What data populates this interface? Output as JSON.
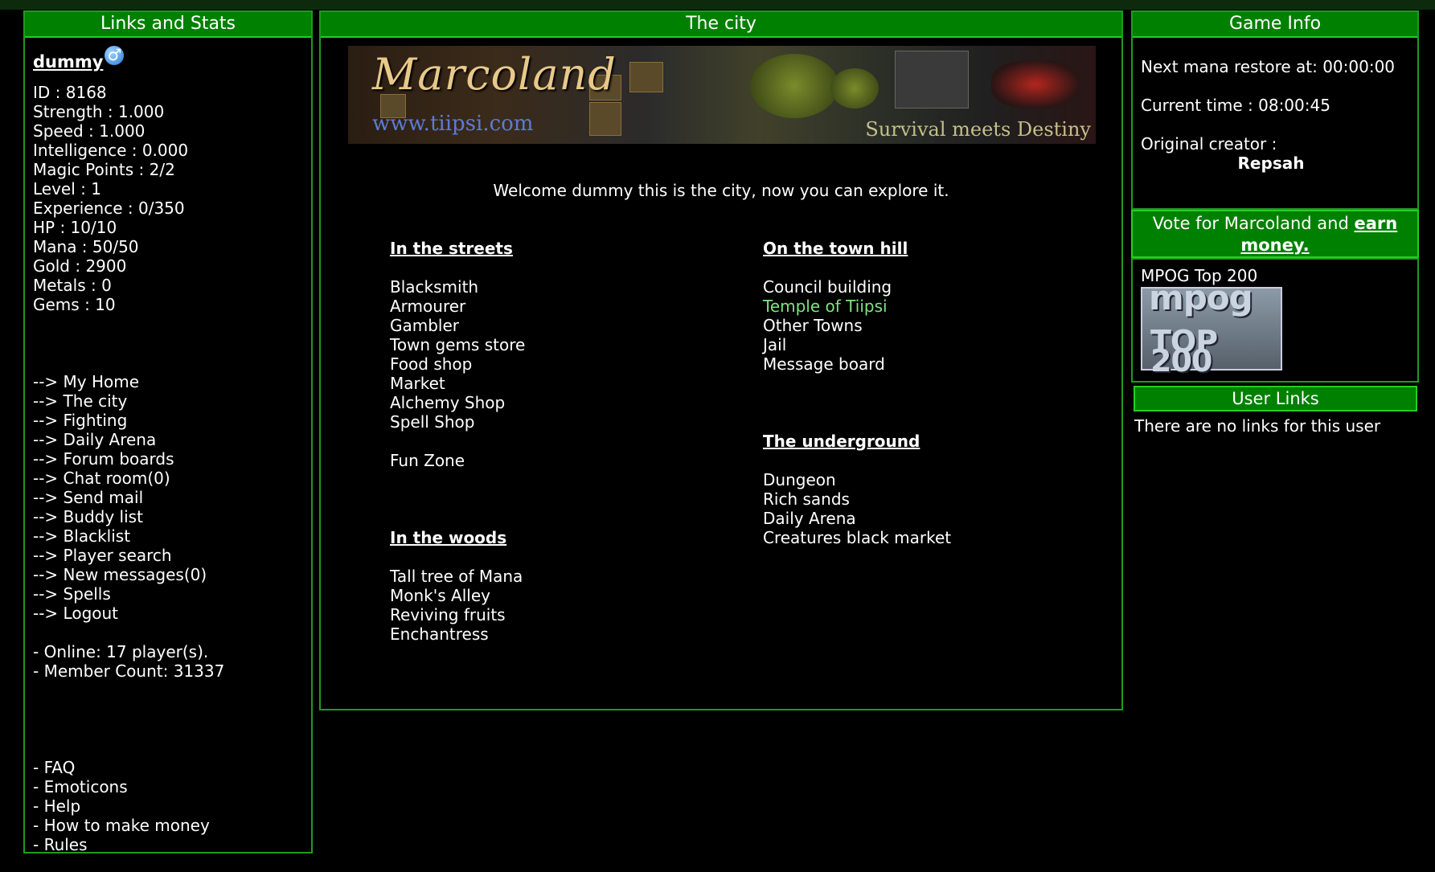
{
  "left": {
    "header": "Links and Stats",
    "username": "dummy",
    "gender_glyph": "♂",
    "stats": [
      "ID : 8168",
      "Strength : 1.000",
      "Speed : 1.000",
      "Intelligence : 0.000",
      "Magic Points : 2/2",
      "Level : 1",
      "Experience : 0/350",
      "HP : 10/10",
      "Mana : 50/50",
      "Gold : 2900",
      "Metals : 0",
      "Gems : 10"
    ],
    "nav": [
      "--> My Home",
      "--> The city",
      "--> Fighting",
      "--> Daily Arena",
      "--> Forum boards",
      "--> Chat room(0)",
      "--> Send mail",
      "--> Buddy list",
      "--> Blacklist",
      "--> Player search",
      "--> New messages(0)",
      "--> Spells",
      "--> Logout"
    ],
    "online": "- Online: 17 player(s).",
    "members": "- Member Count: 31337",
    "help_links": [
      "- FAQ",
      "- Emoticons",
      "- Help",
      "- How to make money",
      "- Rules"
    ]
  },
  "center": {
    "header": "The city",
    "banner": {
      "title": "Marcoland",
      "url": "www.tiipsi.com",
      "tagline": "Survival meets Destiny"
    },
    "welcome": "Welcome dummy this is the city, now you can explore it.",
    "streets": {
      "title": "In the streets",
      "items": [
        "Blacksmith",
        "Armourer",
        "Gambler",
        "Town gems store",
        "Food shop",
        "Market",
        "Alchemy Shop",
        "Spell Shop"
      ],
      "extra": "Fun Zone"
    },
    "woods": {
      "title": "In the woods",
      "items": [
        "Tall tree of Mana",
        "Monk's Alley",
        "Reviving fruits",
        "Enchantress"
      ]
    },
    "hill": {
      "title": "On the town hill",
      "items": [
        "Council building",
        "Temple of Tiipsi",
        "Other Towns",
        "Jail",
        "Message board"
      ]
    },
    "underground": {
      "title": "The underground",
      "items": [
        "Dungeon",
        "Rich sands",
        "Daily Arena",
        "Creatures black market"
      ]
    }
  },
  "right": {
    "header": "Game Info",
    "next_mana": "Next mana restore at: 00:00:00",
    "current_time": "Current time : 08:00:45",
    "creator_label": "Original creator :",
    "creator_name": "Repsah",
    "vote_prefix": "Vote for Marcoland and",
    "vote_link": "earn money.",
    "mpog_label": "MPOG Top 200",
    "mpog_line1": "mpog",
    "mpog_line2": "TOP 200",
    "userlinks_header": "User Links",
    "userlinks_text": "There are no links for this user"
  },
  "colors": {
    "header_bg": "#008000",
    "border": "#1f9a1f",
    "highlight_link": "#7ee37e"
  }
}
